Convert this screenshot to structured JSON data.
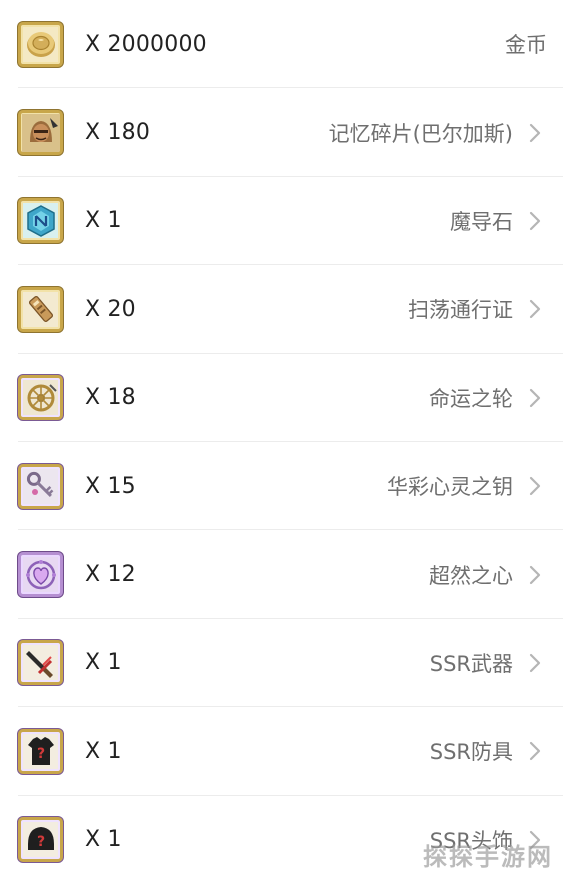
{
  "items": [
    {
      "count": "X 2000000",
      "name": "金币",
      "icon": "gold-coin-icon",
      "chevron": false
    },
    {
      "count": "X 180",
      "name": "记忆碎片(巴尔加斯)",
      "icon": "memory-fragment-icon",
      "chevron": true
    },
    {
      "count": "X 1",
      "name": "魔导石",
      "icon": "magic-stone-icon",
      "chevron": true
    },
    {
      "count": "X 20",
      "name": "扫荡通行证",
      "icon": "sweep-pass-icon",
      "chevron": true
    },
    {
      "count": "X 18",
      "name": "命运之轮",
      "icon": "wheel-of-fate-icon",
      "chevron": true
    },
    {
      "count": "X 15",
      "name": "华彩心灵之钥",
      "icon": "key-icon",
      "chevron": true
    },
    {
      "count": "X 12",
      "name": "超然之心",
      "icon": "heart-crystal-icon",
      "chevron": true
    },
    {
      "count": "X 1",
      "name": "SSR武器",
      "icon": "ssr-weapon-icon",
      "chevron": true
    },
    {
      "count": "X 1",
      "name": "SSR防具",
      "icon": "ssr-armor-icon",
      "chevron": true
    },
    {
      "count": "X 1",
      "name": "SSR头饰",
      "icon": "ssr-headgear-icon",
      "chevron": true
    }
  ],
  "watermark": "探探手游网",
  "colors": {
    "text_primary": "#222222",
    "text_secondary": "#6f6f6f",
    "divider": "#ececec",
    "gold_frame": "#c8a64a"
  }
}
